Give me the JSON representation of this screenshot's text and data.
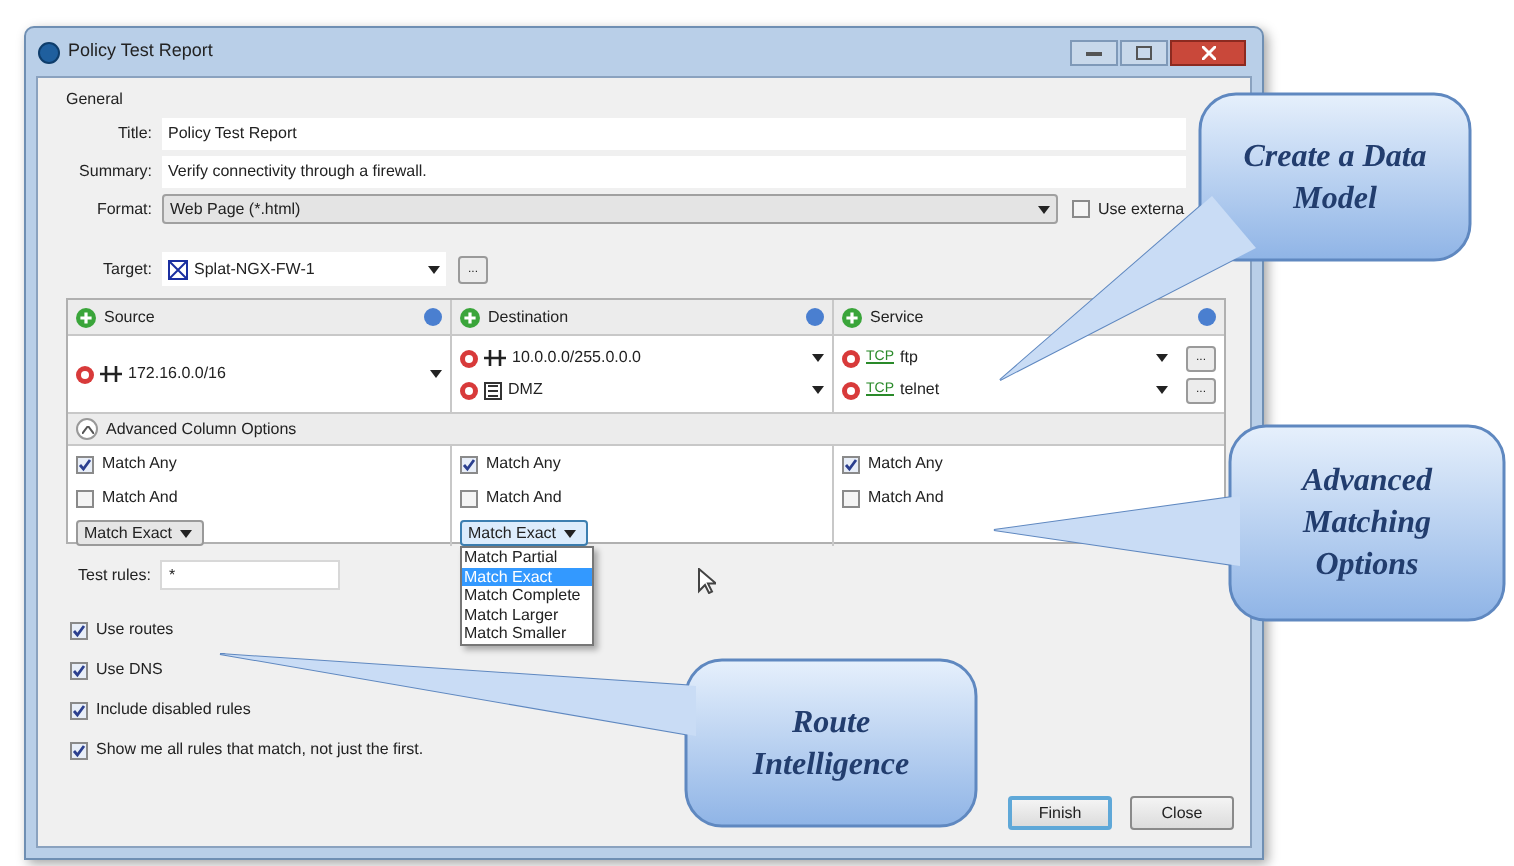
{
  "window": {
    "title": "Policy Test Report"
  },
  "general": {
    "heading": "General",
    "fields": [
      {
        "label": "Title:",
        "value": "Policy Test Report"
      },
      {
        "label": "Summary:",
        "value": "Verify connectivity through a firewall."
      }
    ],
    "format": {
      "label": "Format:",
      "value": "Web Page (*.html)"
    },
    "use_external": {
      "label": "Use externa",
      "checked": false
    }
  },
  "target": {
    "label": "Target:",
    "value": "Splat-NGX-FW-1",
    "button": "..."
  },
  "advanced": {
    "label": "Advanced Column Options",
    "expanded": true
  },
  "columns": [
    {
      "title": "Source",
      "items": [
        {
          "kind": "network",
          "text": "172.16.0.0/16"
        }
      ],
      "match_any": {
        "label": "Match Any",
        "checked": true
      },
      "match_and": {
        "label": "Match And",
        "checked": false
      },
      "mode": {
        "value": "Match Exact",
        "expanded": false
      }
    },
    {
      "title": "Destination",
      "items": [
        {
          "kind": "network",
          "text": "10.0.0.0/255.0.0.0"
        },
        {
          "kind": "zone",
          "text": "DMZ"
        }
      ],
      "match_any": {
        "label": "Match Any",
        "checked": true
      },
      "match_and": {
        "label": "Match And",
        "checked": false
      },
      "mode": {
        "value": "Match Exact",
        "expanded": true,
        "options": [
          {
            "label": "Match Partial",
            "selected": false
          },
          {
            "label": "Match Exact",
            "selected": true
          },
          {
            "label": "Match Complete",
            "selected": false
          },
          {
            "label": "Match Larger",
            "selected": false
          },
          {
            "label": "Match Smaller",
            "selected": false
          }
        ]
      }
    },
    {
      "title": "Service",
      "items": [
        {
          "kind": "service",
          "protocol": "TCP",
          "text": "ftp",
          "button": "..."
        },
        {
          "kind": "service",
          "protocol": "TCP",
          "text": "telnet",
          "button": "..."
        }
      ],
      "match_any": {
        "label": "Match Any",
        "checked": true
      },
      "match_and": {
        "label": "Match And",
        "checked": false
      }
    }
  ],
  "test_rules": {
    "label": "Test rules:",
    "value": "*"
  },
  "options": [
    {
      "label": "Use routes",
      "checked": true
    },
    {
      "label": "Use DNS",
      "checked": true
    },
    {
      "label": "Include disabled rules",
      "checked": true
    },
    {
      "label": "Show me all rules that match, not just the first.",
      "checked": true
    }
  ],
  "buttons": [
    {
      "label": "Finish",
      "default": true
    },
    {
      "label": "Close",
      "default": false
    }
  ],
  "callouts": [
    {
      "text": "Create a Data Model"
    },
    {
      "text": "Advanced Matching Options"
    },
    {
      "text": "Route Intelligence"
    }
  ]
}
